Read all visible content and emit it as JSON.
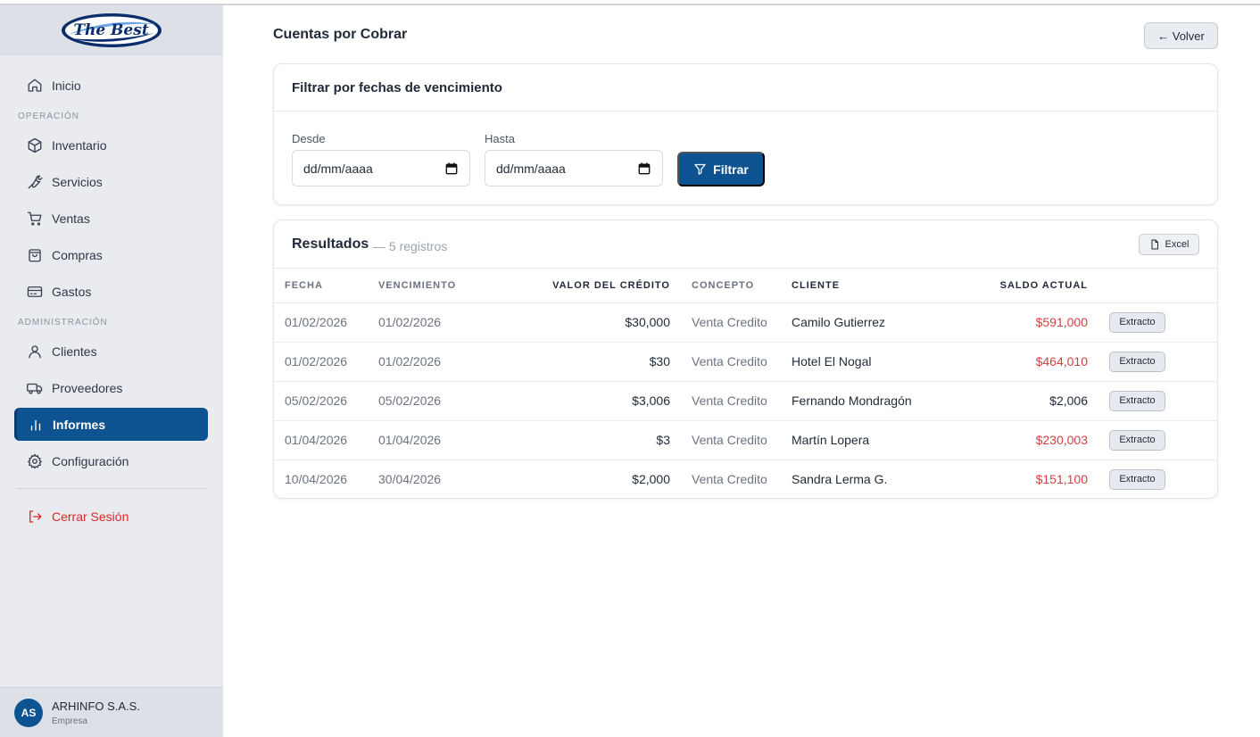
{
  "brand": {
    "logo_text": "The Best",
    "accent": "#0d5392"
  },
  "sidebar": {
    "home": {
      "label": "Inicio",
      "icon": "home-icon"
    },
    "section_operation": "OPERACIÓN",
    "operation_items": [
      {
        "label": "Inventario",
        "icon": "box-icon"
      },
      {
        "label": "Servicios",
        "icon": "wrench-icon"
      },
      {
        "label": "Ventas",
        "icon": "cart-icon"
      },
      {
        "label": "Compras",
        "icon": "bag-icon"
      },
      {
        "label": "Gastos",
        "icon": "card-icon"
      }
    ],
    "section_admin": "ADMINISTRACIÓN",
    "admin_items": [
      {
        "label": "Clientes",
        "icon": "user-icon"
      },
      {
        "label": "Proveedores",
        "icon": "truck-icon"
      },
      {
        "label": "Informes",
        "icon": "bar-chart-icon",
        "active": true
      },
      {
        "label": "Configuración",
        "icon": "gear-icon"
      }
    ],
    "logout": {
      "label": "Cerrar Sesión",
      "icon": "logout-icon"
    },
    "user": {
      "initials": "AS",
      "name": "ARHINFO S.A.S.",
      "role": "Empresa"
    }
  },
  "main": {
    "title": "Cuentas por Cobrar",
    "back_label": "← Volver",
    "filter": {
      "title": "Filtrar por fechas de vencimiento",
      "from_label": "Desde",
      "from_placeholder": "dd/mm/aaaa",
      "to_label": "Hasta",
      "to_placeholder": "dd/mm/aaaa",
      "button_label": "Filtrar"
    },
    "results": {
      "title": "Resultados",
      "count": "— 5 registros",
      "excel_label": "Excel",
      "columns": [
        "FECHA",
        "VENCIMIENTO",
        "VALOR DEL CRÉDITO",
        "CONCEPTO",
        "CLIENTE",
        "SALDO ACTUAL"
      ],
      "action_label": "Extracto",
      "rows": [
        {
          "fecha": "01/02/2026",
          "vencimiento": "01/02/2026",
          "valor": "$30,000",
          "concepto": "Venta Credito",
          "cliente": "Camilo Gutierrez",
          "saldo": "$591,000",
          "overdue": true
        },
        {
          "fecha": "01/02/2026",
          "vencimiento": "01/02/2026",
          "valor": "$30",
          "concepto": "Venta Credito",
          "cliente": "Hotel El Nogal",
          "saldo": "$464,010",
          "overdue": true
        },
        {
          "fecha": "05/02/2026",
          "vencimiento": "05/02/2026",
          "valor": "$3,006",
          "concepto": "Venta Credito",
          "cliente": "Fernando Mondragón",
          "saldo": "$2,006",
          "overdue": false
        },
        {
          "fecha": "01/04/2026",
          "vencimiento": "01/04/2026",
          "valor": "$3",
          "concepto": "Venta Credito",
          "cliente": "Martín Lopera",
          "saldo": "$230,003",
          "overdue": true
        },
        {
          "fecha": "10/04/2026",
          "vencimiento": "30/04/2026",
          "valor": "$2,000",
          "concepto": "Venta Credito",
          "cliente": "Sandra Lerma G.",
          "saldo": "$151,100",
          "overdue": true
        }
      ]
    }
  }
}
